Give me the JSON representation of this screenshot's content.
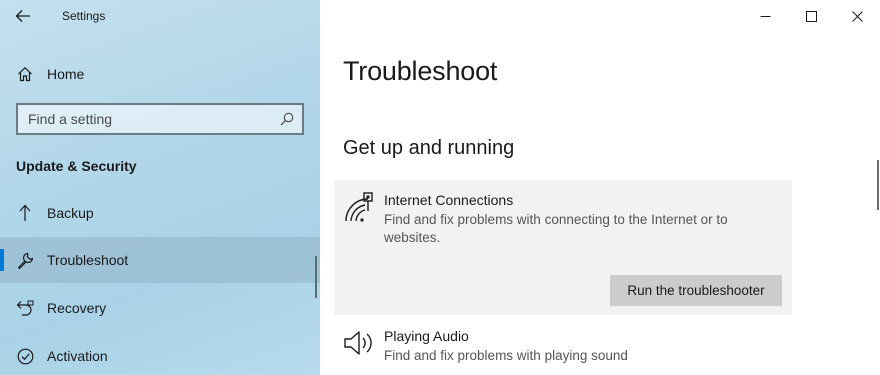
{
  "window": {
    "title": "Settings",
    "controls": [
      "minimize",
      "maximize",
      "close"
    ]
  },
  "sidebar": {
    "home_label": "Home",
    "search": {
      "placeholder": "Find a setting",
      "value": ""
    },
    "section_header": "Update & Security",
    "items": [
      {
        "label": "Backup",
        "icon": "backup-arrow-icon",
        "active": false
      },
      {
        "label": "Troubleshoot",
        "icon": "wrench-icon",
        "active": true
      },
      {
        "label": "Recovery",
        "icon": "recovery-icon",
        "active": false
      },
      {
        "label": "Activation",
        "icon": "activation-check-icon",
        "active": false
      }
    ]
  },
  "main": {
    "page_title": "Troubleshoot",
    "group_header": "Get up and running",
    "troubleshooters": [
      {
        "title": "Internet Connections",
        "description": "Find and fix problems with connecting to the Internet or to websites.",
        "icon": "network-wifi-icon",
        "selected": true,
        "button_label": "Run the troubleshooter"
      },
      {
        "title": "Playing Audio",
        "description": "Find and fix problems with playing sound",
        "icon": "speaker-icon",
        "selected": false
      }
    ]
  },
  "colors": {
    "accent": "#0078d7",
    "sidebar_bg": "#b4d8ea",
    "card_bg": "#f2f2f2",
    "button_bg": "#cccccc"
  }
}
